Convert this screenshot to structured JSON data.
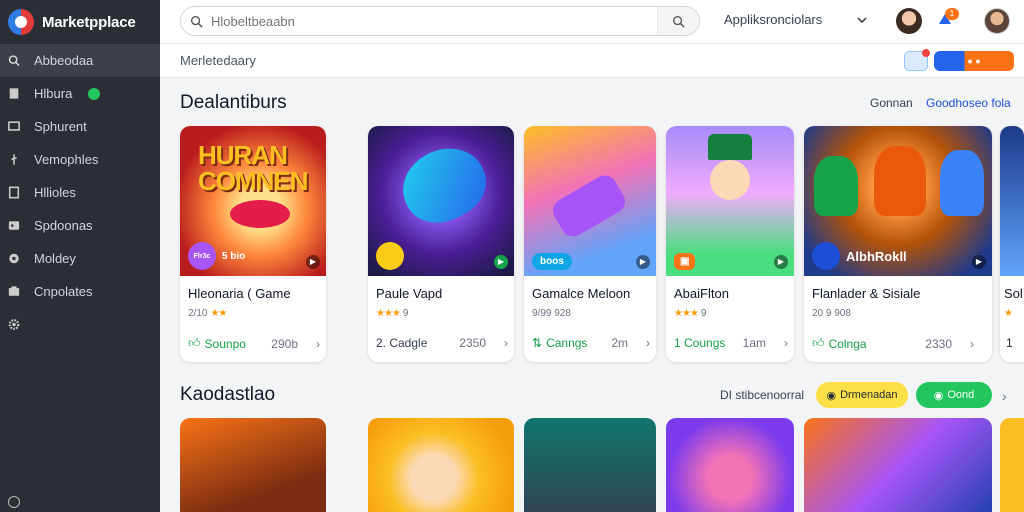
{
  "sidebar": {
    "brand": "Marketpplace",
    "items": [
      {
        "label": "Abbeodaa",
        "icon": "search-icon",
        "active": true
      },
      {
        "label": "Hlbura",
        "icon": "bookmark-icon",
        "dot": true
      },
      {
        "label": "Sphurent",
        "icon": "chat-icon"
      },
      {
        "label": "Vemophles",
        "icon": "pin-icon"
      },
      {
        "label": "Hllioles",
        "icon": "document-icon"
      },
      {
        "label": "Spdoonas",
        "icon": "gamepad-icon"
      },
      {
        "label": "Moldey",
        "icon": "circle-icon"
      },
      {
        "label": "Cnpolates",
        "icon": "box-icon"
      },
      {
        "label": "",
        "icon": "gear-icon"
      }
    ]
  },
  "topbar": {
    "search_placeholder": "Hlobeltbeaabn",
    "app_select": "Appliksronciolars",
    "notification_count": "1"
  },
  "subheader": {
    "breadcrumb": "Merletedaary",
    "switch_label": "● ●"
  },
  "section1": {
    "title": "Dealantiburs",
    "link_plain": "Gonnan",
    "link_blue": "Goodhoseo fola",
    "cards": [
      {
        "title": "Hleonaria ( Game",
        "rating": "2/10",
        "stars": "★★",
        "action": "Sounpo",
        "meta": "290b",
        "art_label": "5 bio",
        "badge": "Flr3c",
        "badge_color": "#a855f7"
      },
      {
        "title": "Paule Vapd",
        "rating": "",
        "stars": "★★★",
        "rating_suffix": "9",
        "action": "2. Cadgle",
        "meta": "2350",
        "art_label": "",
        "badge": "",
        "badge_color": "#facc15"
      },
      {
        "title": "Gamalce Meloon",
        "rating": "9/99 928",
        "stars": "",
        "action": "Canngs",
        "meta": "2m",
        "art_label": "boos",
        "badge": "",
        "badge_color": "#0ea5e9"
      },
      {
        "title": "AbaiFlton",
        "rating": "",
        "stars": "★★★",
        "rating_suffix": "9",
        "action": "1 Coungs",
        "meta": "1am",
        "art_label": "",
        "badge": "",
        "badge_color": "#f97316"
      },
      {
        "title": "Flanlader & Sisiale",
        "rating": "20 9 908",
        "stars": "",
        "action": "Colnga",
        "meta": "2330",
        "art_label": "AlbhRokll",
        "badge": "",
        "badge_color": "#1d4ed8"
      },
      {
        "title": "Sol",
        "rating": "",
        "stars": "★",
        "action": "1",
        "meta": "",
        "art_label": "",
        "badge": "",
        "badge_color": "#60a5fa"
      }
    ]
  },
  "section2": {
    "title": "Kaodastlao",
    "link_plain": "DI stibcenoorral",
    "tag_yellow": "Drmenadan",
    "tag_green": "Oond"
  }
}
